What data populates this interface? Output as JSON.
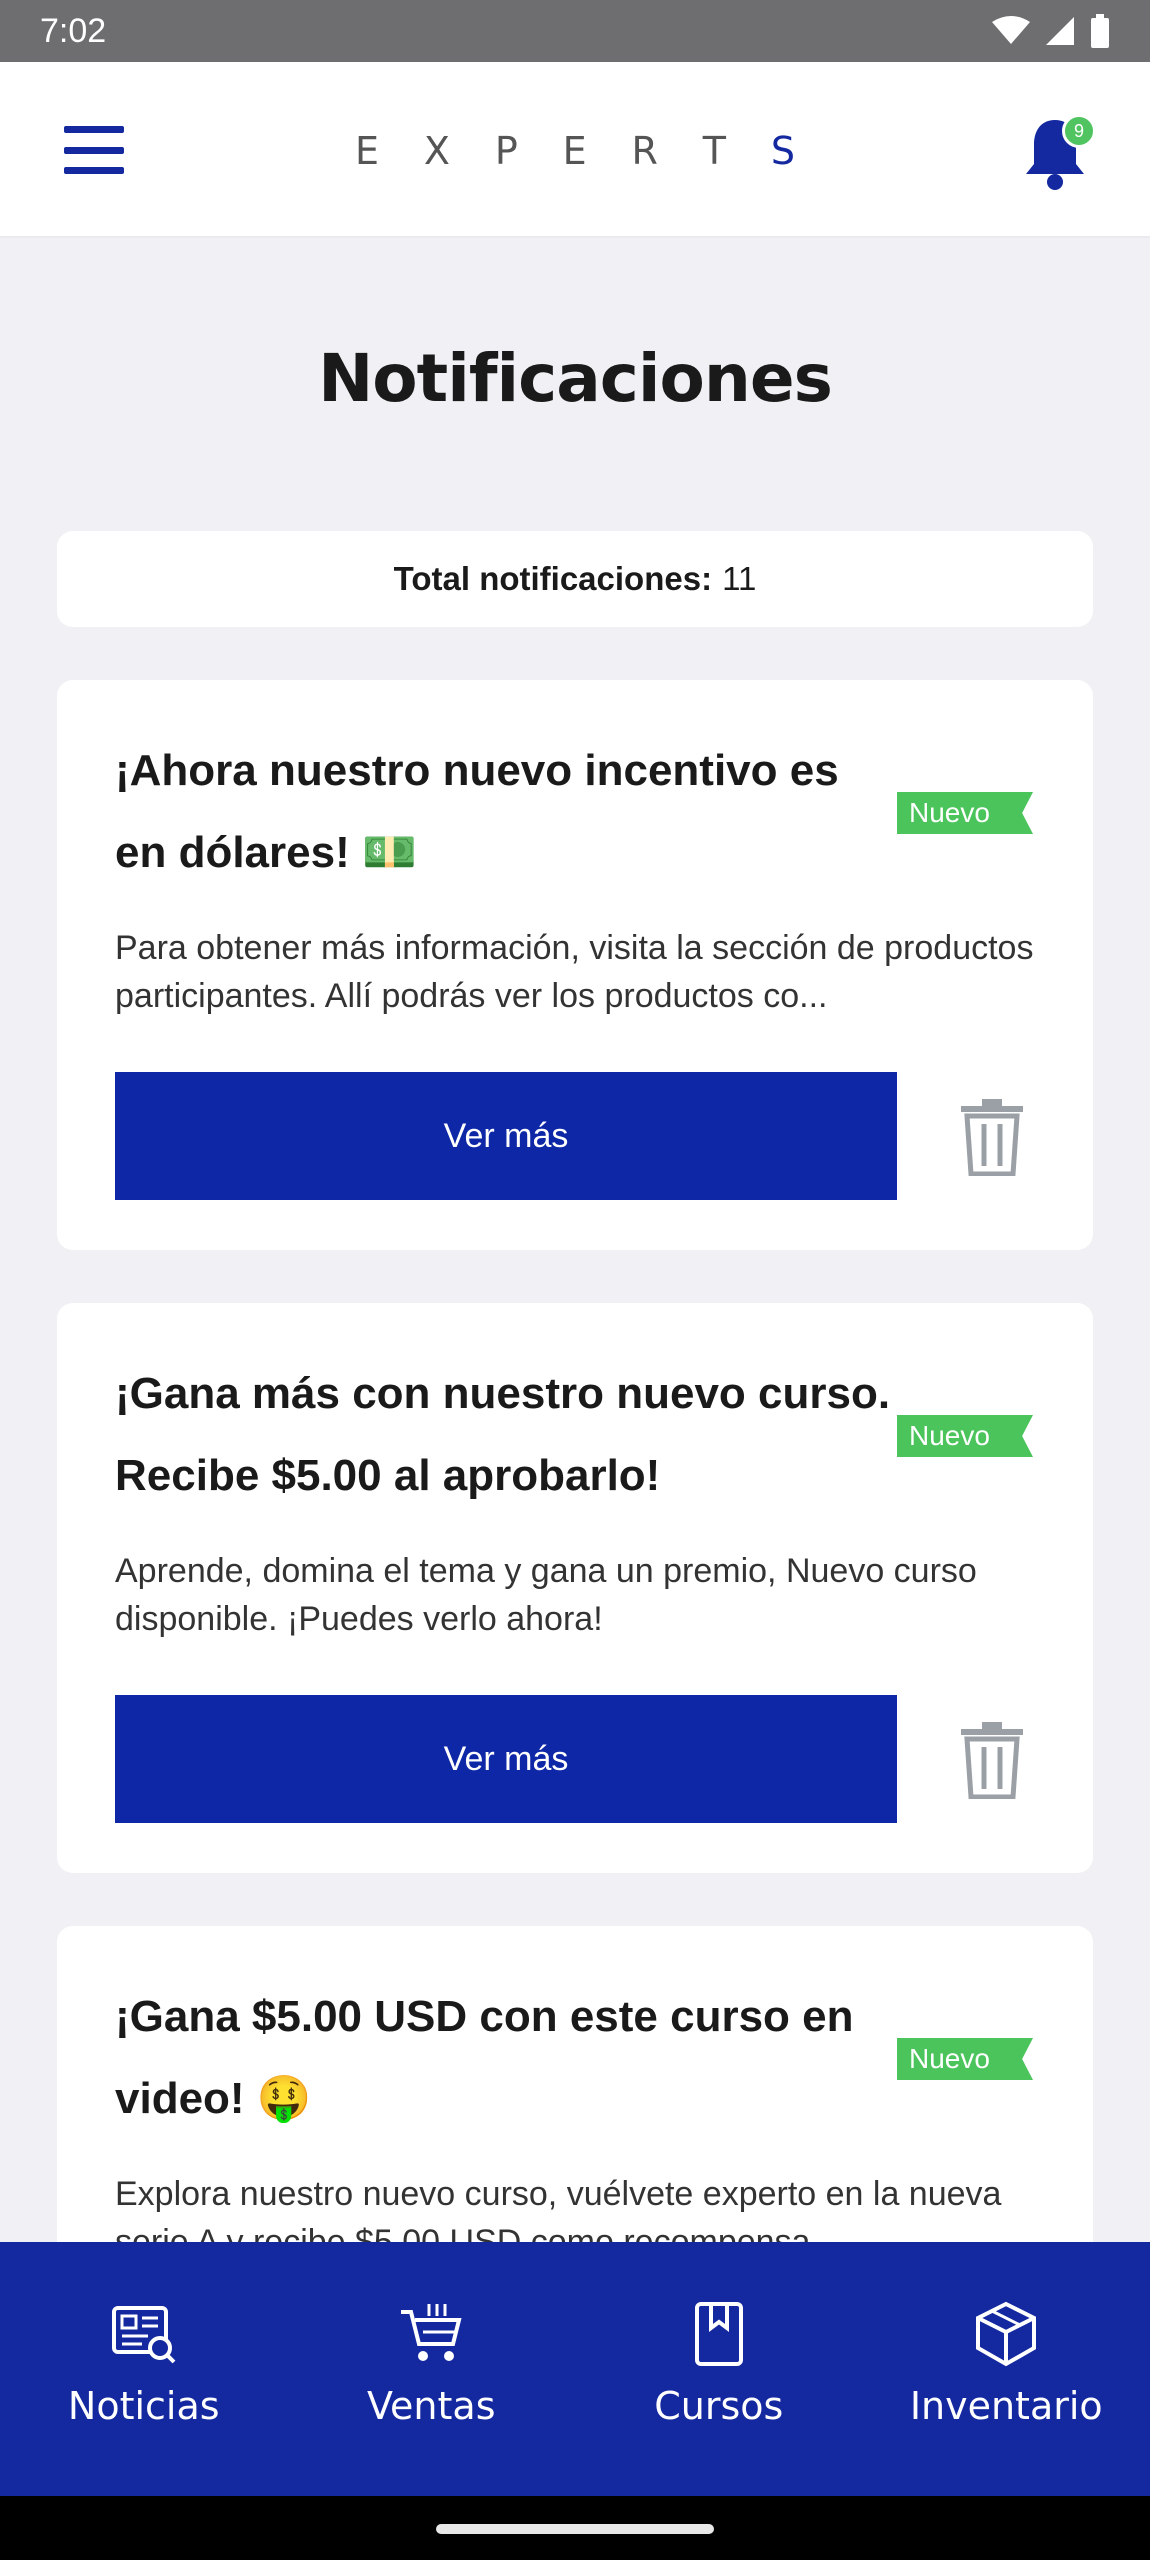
{
  "status_bar": {
    "time": "7:02"
  },
  "header": {
    "logo_letters": [
      "E",
      "X",
      "P",
      "E",
      "R",
      "T",
      "S"
    ],
    "notification_count": "9"
  },
  "page_title": "Notificaciones",
  "total": {
    "label": "Total notificaciones:",
    "value": "11"
  },
  "notifications": [
    {
      "title": "¡Ahora nuestro nuevo incentivo es en dólares! 💵",
      "badge": "Nuevo",
      "description": "Para obtener más información, visita la sección de productos participantes. Allí podrás ver los productos co...",
      "button": "Ver más"
    },
    {
      "title": "¡Gana más con nuestro nuevo curso. Recibe $5.00 al aprobarlo!",
      "badge": "Nuevo",
      "description": "Aprende, domina el tema y gana un premio, Nuevo curso disponible. ¡Puedes verlo ahora!",
      "button": "Ver más"
    },
    {
      "title": "¡Gana $5.00 USD con este curso en video! 🤑",
      "badge": "Nuevo",
      "description": "Explora nuestro nuevo curso, vuélvete experto en la nueva serie A y recibe $5.00 USD como recompensa"
    }
  ],
  "bottom_nav": [
    {
      "label": "Noticias",
      "icon": "news-icon"
    },
    {
      "label": "Ventas",
      "icon": "cart-icon"
    },
    {
      "label": "Cursos",
      "icon": "bookmark-icon"
    },
    {
      "label": "Inventario",
      "icon": "box-icon"
    }
  ],
  "colors": {
    "primary": "#1428a0",
    "button": "#0d27a6",
    "badge": "#4cc45c"
  }
}
